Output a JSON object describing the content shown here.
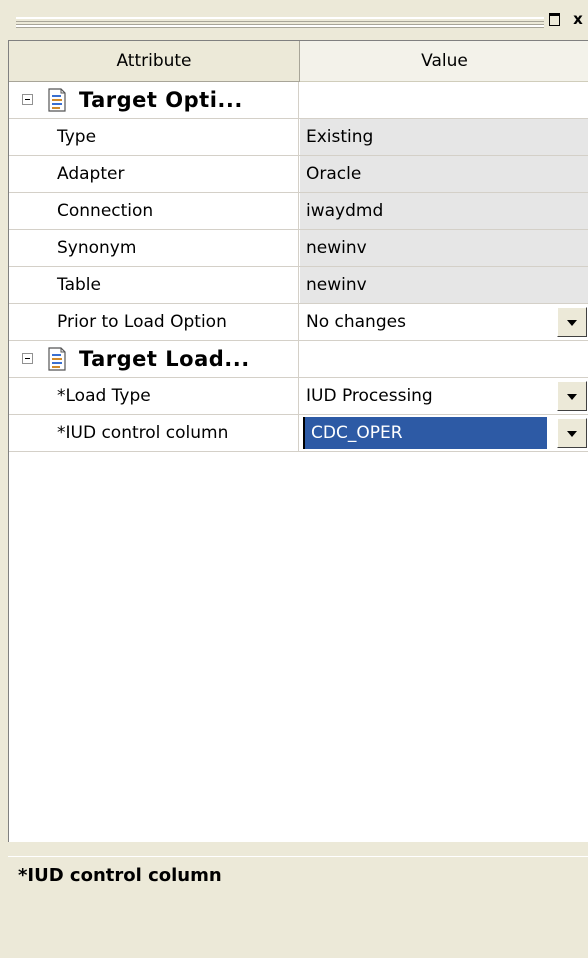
{
  "window": {
    "restore_glyph": "restore-icon",
    "close_glyph": "x"
  },
  "grid": {
    "headers": {
      "attribute": "Attribute",
      "value": "Value"
    },
    "sections": [
      {
        "label": "Target Opti...",
        "rows": [
          {
            "attribute": "Type",
            "value": "Existing"
          },
          {
            "attribute": "Adapter",
            "value": "Oracle"
          },
          {
            "attribute": "Connection",
            "value": "iwaydmd"
          },
          {
            "attribute": "Synonym",
            "value": "newinv"
          },
          {
            "attribute": "Table",
            "value": "newinv"
          },
          {
            "attribute": "Prior to Load Option",
            "value": "No changes"
          }
        ]
      },
      {
        "label": "Target Load...",
        "rows": [
          {
            "attribute": "*Load Type",
            "value": "IUD Processing"
          },
          {
            "attribute": "*IUD control column",
            "value": "CDC_OPER"
          }
        ]
      }
    ]
  },
  "description": {
    "title": "*IUD control column"
  },
  "colors": {
    "selection": "#2d5aa5",
    "panel": "#ece9d8",
    "readonly_cell": "#e6e6e6"
  }
}
